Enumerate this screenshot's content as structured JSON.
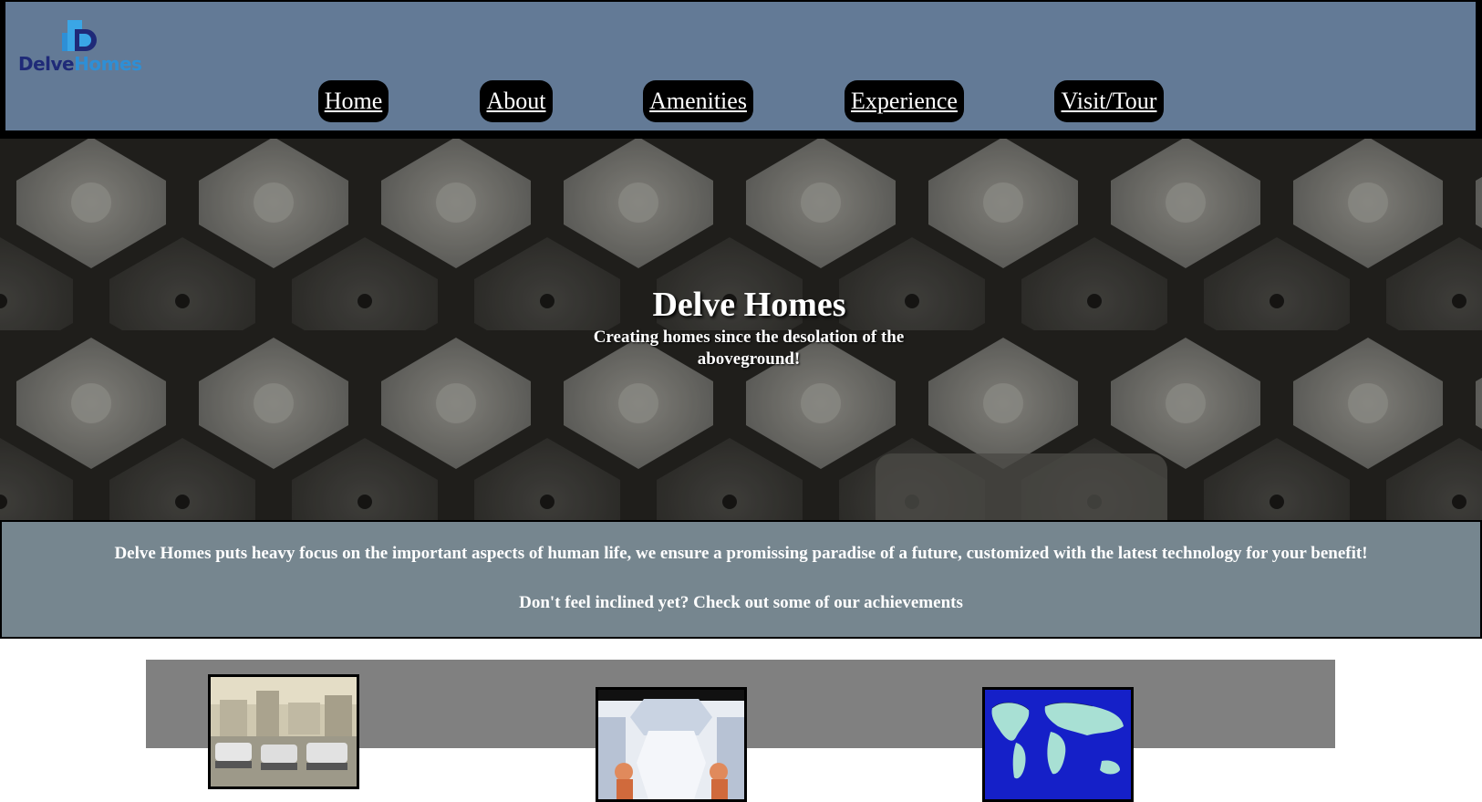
{
  "brand": {
    "logo_word_1": "Delve",
    "logo_word_2": "Homes",
    "colors": {
      "header_bg": "#637a96",
      "logo_dark": "#1f2a78",
      "logo_light": "#2e8fd6",
      "info_bg": "#76868f",
      "achievements_bg": "#808080"
    }
  },
  "nav": {
    "items": [
      {
        "label": "Home"
      },
      {
        "label": "About"
      },
      {
        "label": "Amenities"
      },
      {
        "label": "Experience"
      },
      {
        "label": "Visit/Tour"
      }
    ]
  },
  "hero": {
    "title": "Delve Homes",
    "subtitle": "Creating homes since the desolation of the aboveground!"
  },
  "info": {
    "line1": "Delve Homes puts heavy focus on the important aspects of human life, we ensure a promissing paradise of a future, customized with the latest technology for your benefit!",
    "line2": "Don't feel inclined yet? Check out some of our achievements"
  },
  "achievements": {
    "images": [
      {
        "icon": "futuristic-city-image"
      },
      {
        "icon": "space-station-interior-image"
      },
      {
        "icon": "world-map-image"
      }
    ]
  }
}
